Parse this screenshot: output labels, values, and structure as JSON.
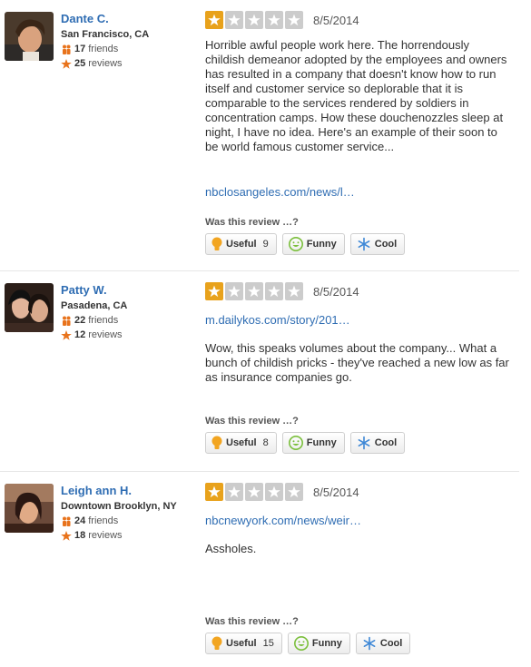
{
  "colors": {
    "star_on": "#e8a21c",
    "star_off": "#cccccc",
    "name": "#2f6db3",
    "link": "#2f6db3"
  },
  "vote_prompt": "Was this review …?",
  "buttons": {
    "useful": "Useful",
    "funny": "Funny",
    "cool": "Cool"
  },
  "reviews": [
    {
      "user": {
        "name": "Dante C.",
        "location": "San Francisco, CA",
        "friends": "17",
        "friends_label": "friends",
        "reviews": "25",
        "reviews_label": "reviews"
      },
      "rating": 1,
      "date": "8/5/2014",
      "text": "Horrible awful people work here. The horrendously childish demeanor adopted by the employees and owners has resulted in a company that doesn't know how to run itself and customer service so deplorable that it is comparable to the services rendered by soldiers in concentration camps. How these douchenozzles sleep at night, I have no idea. Here's an example of their soon to be world famous customer service...",
      "link": "nbclosangeles.com/news/l…",
      "useful_count": "9"
    },
    {
      "user": {
        "name": "Patty W.",
        "location": "Pasadena, CA",
        "friends": "22",
        "friends_label": "friends",
        "reviews": "12",
        "reviews_label": "reviews"
      },
      "rating": 1,
      "date": "8/5/2014",
      "link": "m.dailykos.com/story/201…",
      "text": "Wow, this speaks volumes about the company... What a bunch of childish pricks - they've reached a new low as far as insurance companies go.",
      "useful_count": "8"
    },
    {
      "user": {
        "name": "Leigh ann H.",
        "location": "Downtown Brooklyn, NY",
        "friends": "24",
        "friends_label": "friends",
        "reviews": "18",
        "reviews_label": "reviews"
      },
      "rating": 1,
      "date": "8/5/2014",
      "link": "nbcnewyork.com/news/weir…",
      "text": "Assholes.",
      "useful_count": "15"
    }
  ]
}
